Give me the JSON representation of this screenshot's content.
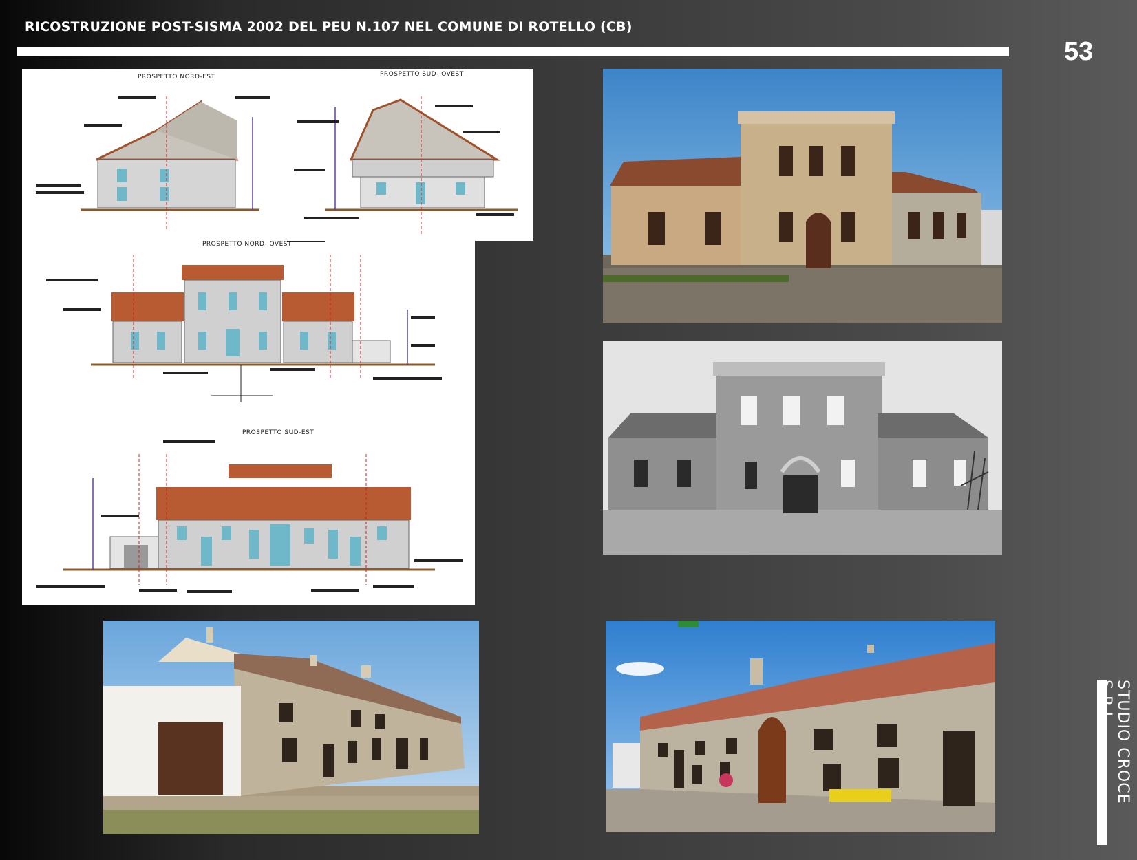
{
  "header": {
    "title": "RICOSTRUZIONE POST-SISMA 2002 DEL PEU N.107 NEL COMUNE DI ROTELLO (CB)",
    "page_number": "53"
  },
  "footer": {
    "brand": "STUDIO CROCE S.R.L."
  },
  "drawings": {
    "labels": {
      "nord_est": "PROSPETTO NORD-EST",
      "sud_ovest": "PROSPETTO SUD- OVEST",
      "nord_ovest": "PROSPETTO NORD- OVEST",
      "sud_est": "PROSPETTO SUD-EST"
    }
  },
  "photos": {
    "items": [
      "color-photo",
      "bw-photo",
      "color-photo",
      "color-photo"
    ]
  },
  "colors": {
    "stone": "#b9ad95",
    "roof": "#a0522d",
    "sky": "#5f9fd6",
    "accent_line": "#d22020"
  }
}
